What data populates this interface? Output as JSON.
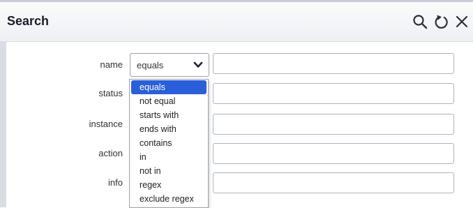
{
  "header": {
    "title": "Search",
    "icons": [
      "search-icon",
      "refresh-icon",
      "close-icon"
    ]
  },
  "form": {
    "labels": [
      "name",
      "status",
      "instance",
      "action",
      "info"
    ],
    "operator_select": {
      "value": "equals"
    },
    "dropdown_options": [
      "equals",
      "not equal",
      "starts with",
      "ends with",
      "contains",
      "in",
      "not in",
      "regex",
      "exclude regex"
    ]
  },
  "colors": {
    "selected_option": "#2b5fd9",
    "header_text": "#1a1f2b",
    "border": "#aeb4bf"
  }
}
